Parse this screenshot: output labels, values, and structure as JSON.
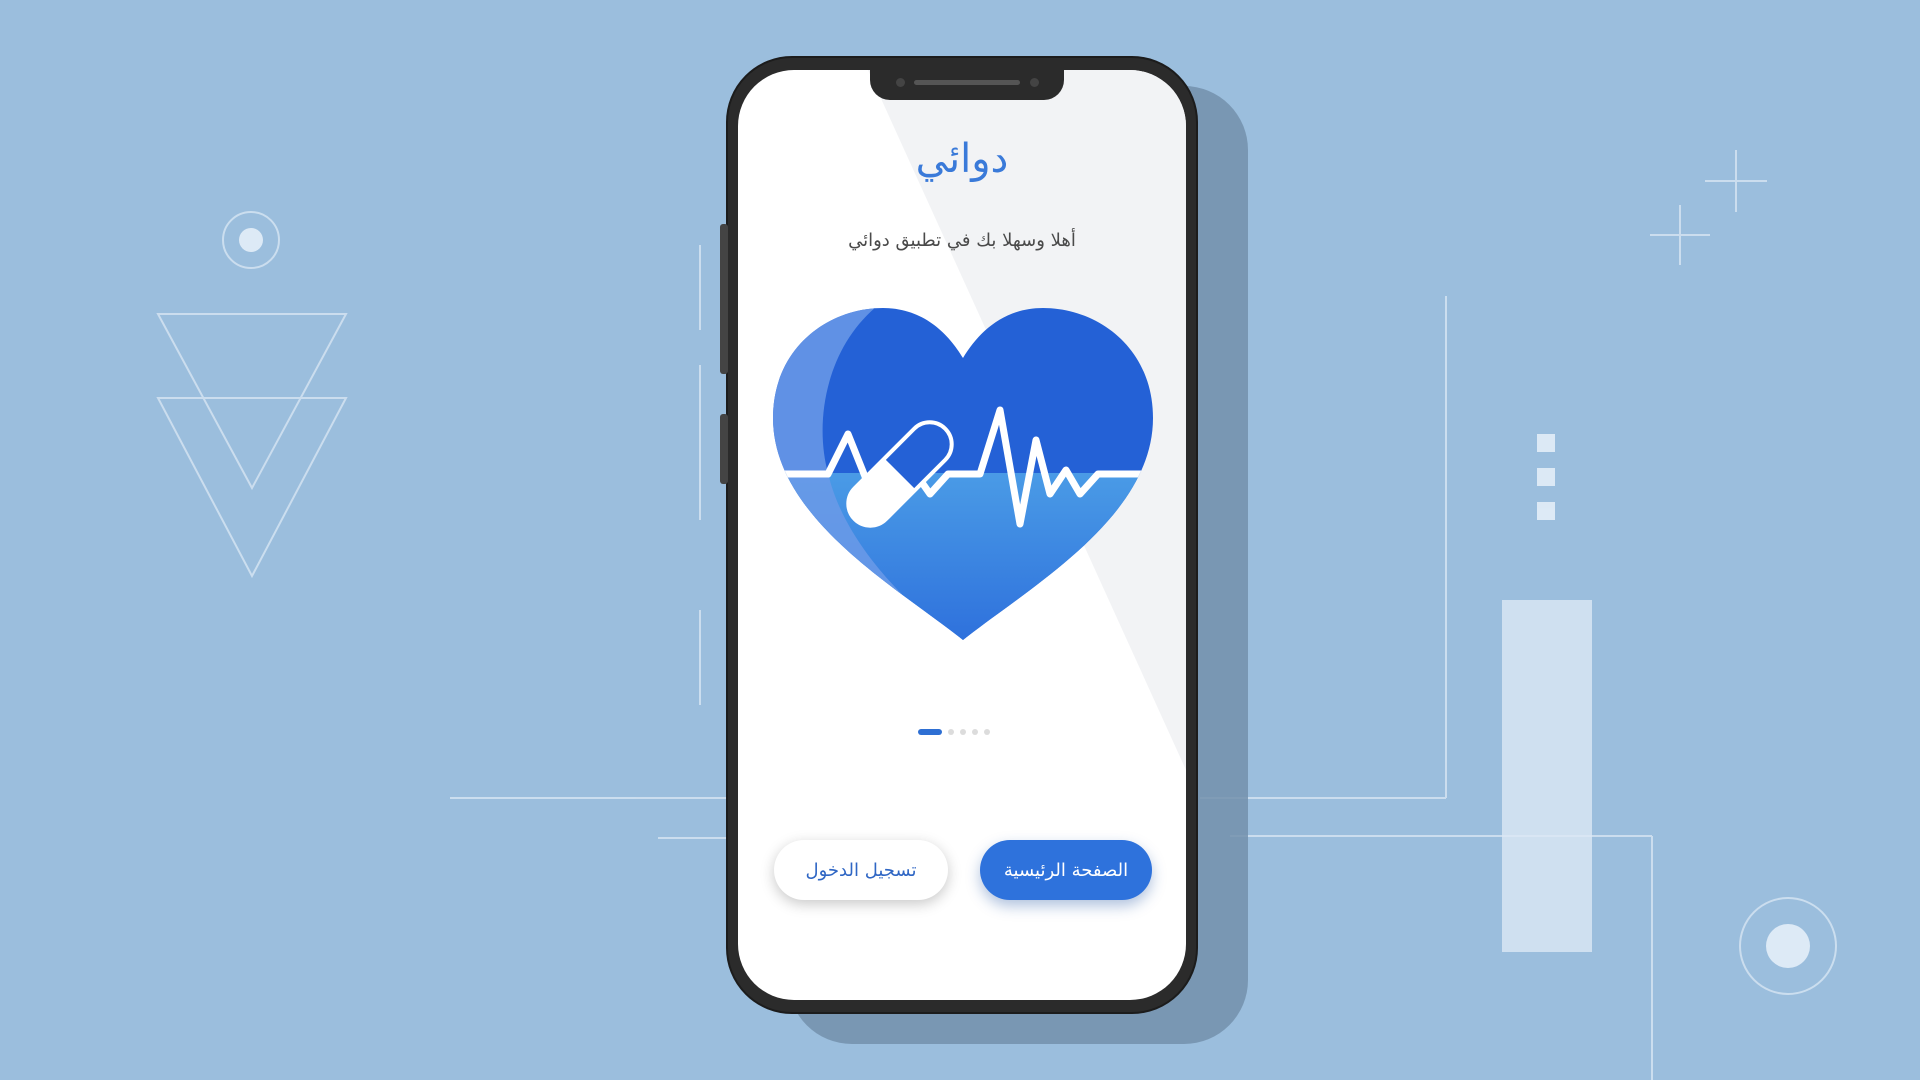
{
  "app": {
    "title": "دوائي",
    "welcome_text": "أهلا وسهلا بك في تطبيق دوائي"
  },
  "onboarding": {
    "current_page": 1,
    "total_pages": 5
  },
  "buttons": {
    "home_label": "الصفحة الرئيسية",
    "login_label": "تسجيل الدخول"
  },
  "colors": {
    "background": "#9bbedd",
    "accent": "#2e72dc",
    "heart_dark": "#2461d6",
    "heart_light": "#5b95e8"
  },
  "icons": {
    "hero": "heart-pulse-pill-icon"
  }
}
